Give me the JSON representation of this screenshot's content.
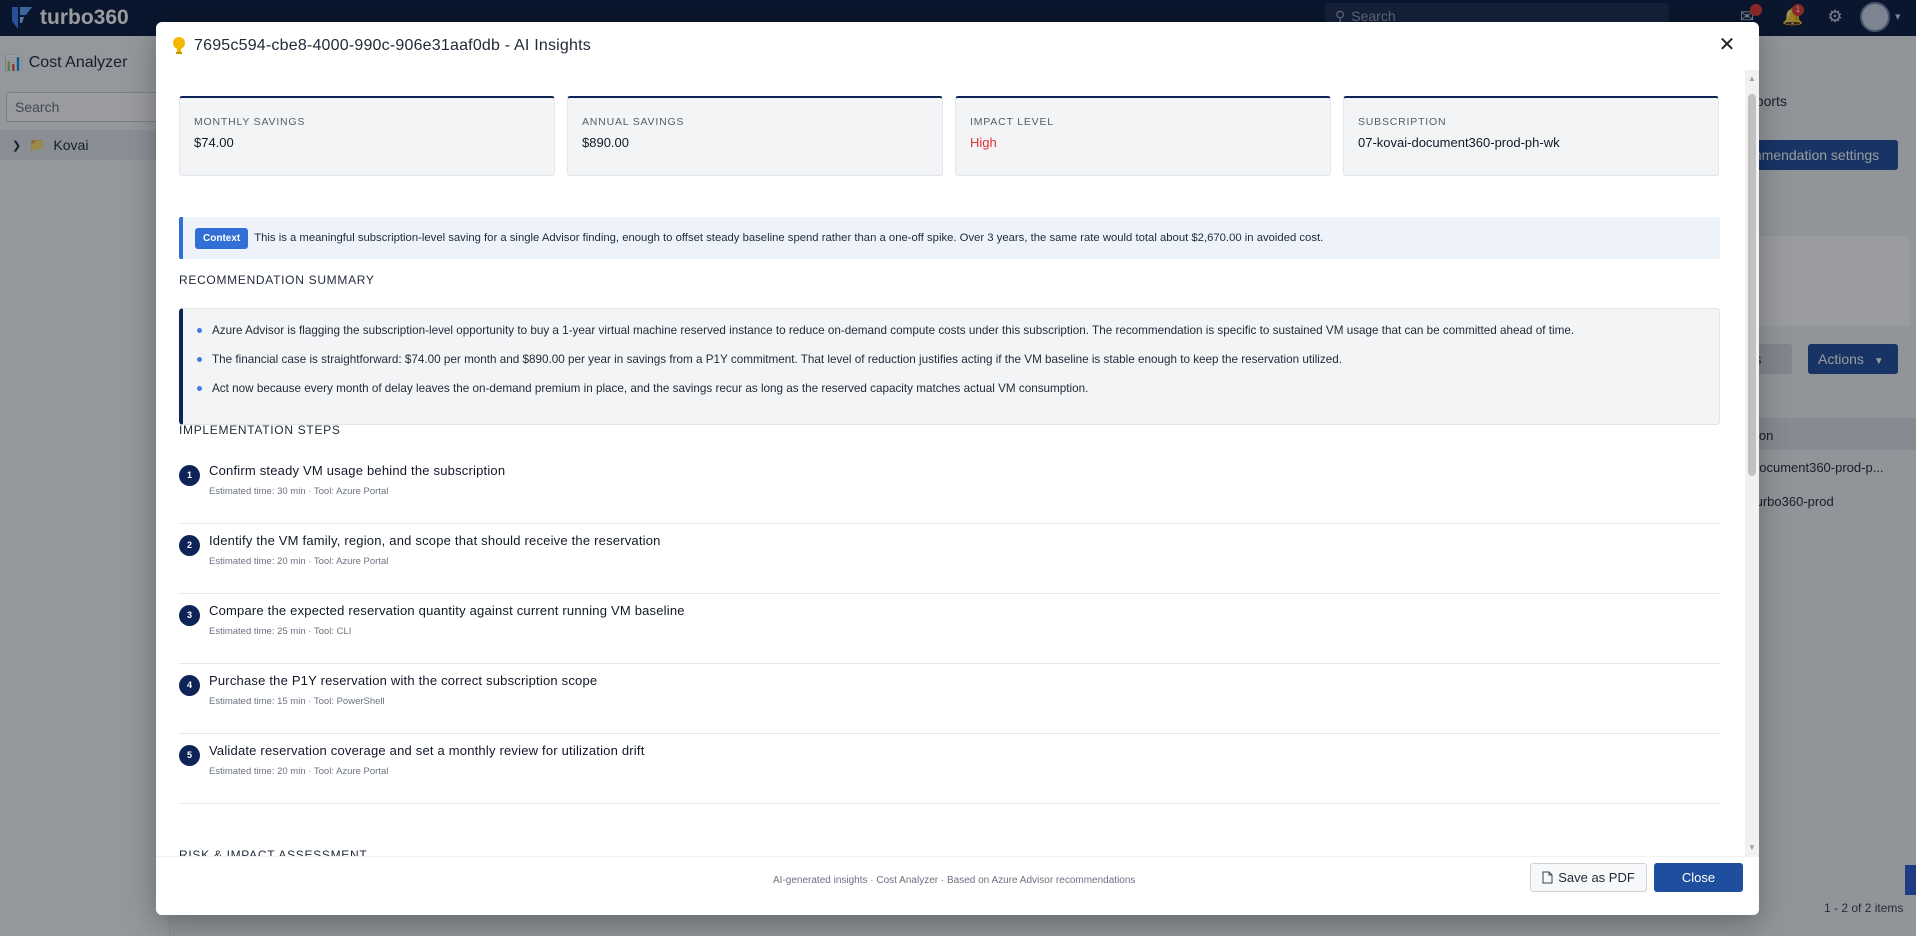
{
  "app": {
    "brand": "turbo360",
    "search_placeholder": "Search",
    "notification_count": "1"
  },
  "left_panel": {
    "title": "Cost Analyzer",
    "search_placeholder": "Search",
    "tree_item": "Kovai"
  },
  "background": {
    "tab_label": "eports",
    "settings_button": "mmendation settings",
    "filters_button": "ers",
    "actions_button": "Actions",
    "table_header": "ion",
    "rows": [
      "document360-prod-p...",
      "turbo360-prod"
    ],
    "pagination": "1 - 2 of 2 items"
  },
  "modal": {
    "title": "7695c594-cbe8-4000-990c-906e31aaf0db - AI Insights",
    "stats": [
      {
        "label": "MONTHLY SAVINGS",
        "value": "$74.00"
      },
      {
        "label": "ANNUAL SAVINGS",
        "value": "$890.00"
      },
      {
        "label": "IMPACT LEVEL",
        "value": "High"
      },
      {
        "label": "SUBSCRIPTION",
        "value": "07-kovai-document360-prod-ph-wk"
      }
    ],
    "context": {
      "tag": "Context",
      "text": "This is a meaningful subscription-level saving for a single Advisor finding, enough to offset steady baseline spend rather than a one-off spike. Over 3 years, the same rate would total about $2,670.00 in avoided cost."
    },
    "summary_heading": "RECOMMENDATION SUMMARY",
    "summary_bullets": [
      "Azure Advisor is flagging the subscription-level opportunity to buy a 1-year virtual machine reserved instance to reduce on-demand compute costs under this subscription. The recommendation is specific to sustained VM usage that can be committed ahead of time.",
      "The financial case is straightforward: $74.00 per month and $890.00 per year in savings from a P1Y commitment. That level of reduction justifies acting if the VM baseline is stable enough to keep the reservation utilized.",
      "Act now because every month of delay leaves the on-demand premium in place, and the savings recur as long as the reserved capacity matches actual VM consumption."
    ],
    "steps_heading": "IMPLEMENTATION STEPS",
    "steps": [
      {
        "num": "1",
        "title": "Confirm steady VM usage behind the subscription",
        "meta": "Estimated time: 30 min · Tool: Azure Portal"
      },
      {
        "num": "2",
        "title": "Identify the VM family, region, and scope that should receive the reservation",
        "meta": "Estimated time: 20 min · Tool: Azure Portal"
      },
      {
        "num": "3",
        "title": "Compare the expected reservation quantity against current running VM baseline",
        "meta": "Estimated time: 25 min · Tool: CLI"
      },
      {
        "num": "4",
        "title": "Purchase the P1Y reservation with the correct subscription scope",
        "meta": "Estimated time: 15 min · Tool: PowerShell"
      },
      {
        "num": "5",
        "title": "Validate reservation coverage and set a monthly review for utilization drift",
        "meta": "Estimated time: 20 min · Tool: Azure Portal"
      }
    ],
    "risk_heading": "RISK & IMPACT ASSESSMENT",
    "footer_note": "AI-generated insights · Cost Analyzer · Based on Azure Advisor recommendations",
    "save_pdf": "Save as PDF",
    "close": "Close"
  },
  "colors": {
    "navy": "#0a1b3d",
    "accent_blue": "#1f4e9e",
    "context_blue": "#2f6fd6",
    "high_red": "#e03131"
  }
}
